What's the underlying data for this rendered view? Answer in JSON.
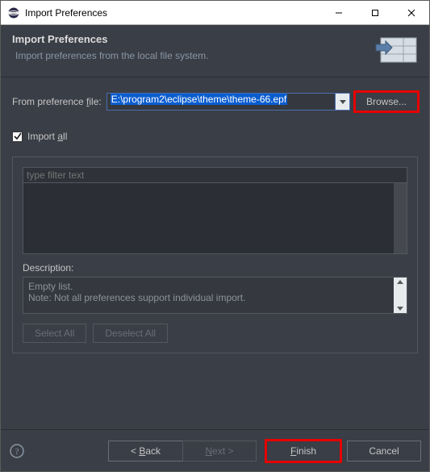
{
  "titlebar": {
    "title": "Import Preferences"
  },
  "header": {
    "title": "Import Preferences",
    "subtitle": "Import preferences from the local file system."
  },
  "file_row": {
    "label_pre": "From preference ",
    "label_u": "f",
    "label_post": "ile:",
    "value": "E:\\program2\\eclipse\\theme\\theme-66.epf",
    "browse": "Browse..."
  },
  "import_all": {
    "label_pre": "Import ",
    "label_u": "a",
    "label_post": "ll",
    "checked": true
  },
  "group": {
    "filter_placeholder": "type filter text",
    "description_label": "Description:",
    "description_line1": "Empty list.",
    "description_line2": "Note: Not all preferences support individual import.",
    "select_all": "Select All",
    "deselect_all": "Deselect All"
  },
  "footer": {
    "back": "< Back",
    "next": "Next >",
    "finish": "Finish",
    "cancel": "Cancel"
  }
}
